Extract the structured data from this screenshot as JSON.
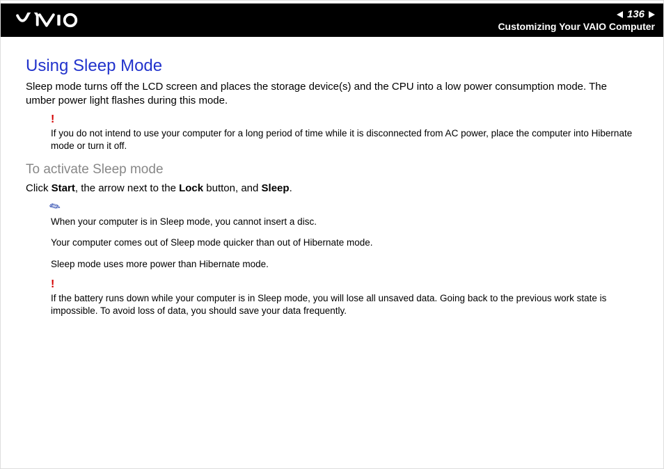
{
  "header": {
    "page_number": "136",
    "section": "Customizing Your VAIO Computer"
  },
  "content": {
    "title": "Using Sleep Mode",
    "intro": "Sleep mode turns off the LCD screen and places the storage device(s) and the CPU into a low power consumption mode. The umber power light flashes during this mode.",
    "warning1": "If you do not intend to use your computer for a long period of time while it is disconnected from AC power, place the computer into Hibernate mode or turn it off.",
    "subtitle": "To activate Sleep mode",
    "step_prefix": "Click ",
    "step_b1": "Start",
    "step_mid1": ", the arrow next to the ",
    "step_b2": "Lock",
    "step_mid2": " button, and ",
    "step_b3": "Sleep",
    "step_suffix": ".",
    "tip1": "When your computer is in Sleep mode, you cannot insert a disc.",
    "tip2": "Your computer comes out of Sleep mode quicker than out of Hibernate mode.",
    "tip3": "Sleep mode uses more power than Hibernate mode.",
    "warning2": "If the battery runs down while your computer is in Sleep mode, you will lose all unsaved data. Going back to the previous work state is impossible. To avoid loss of data, you should save your data frequently."
  }
}
